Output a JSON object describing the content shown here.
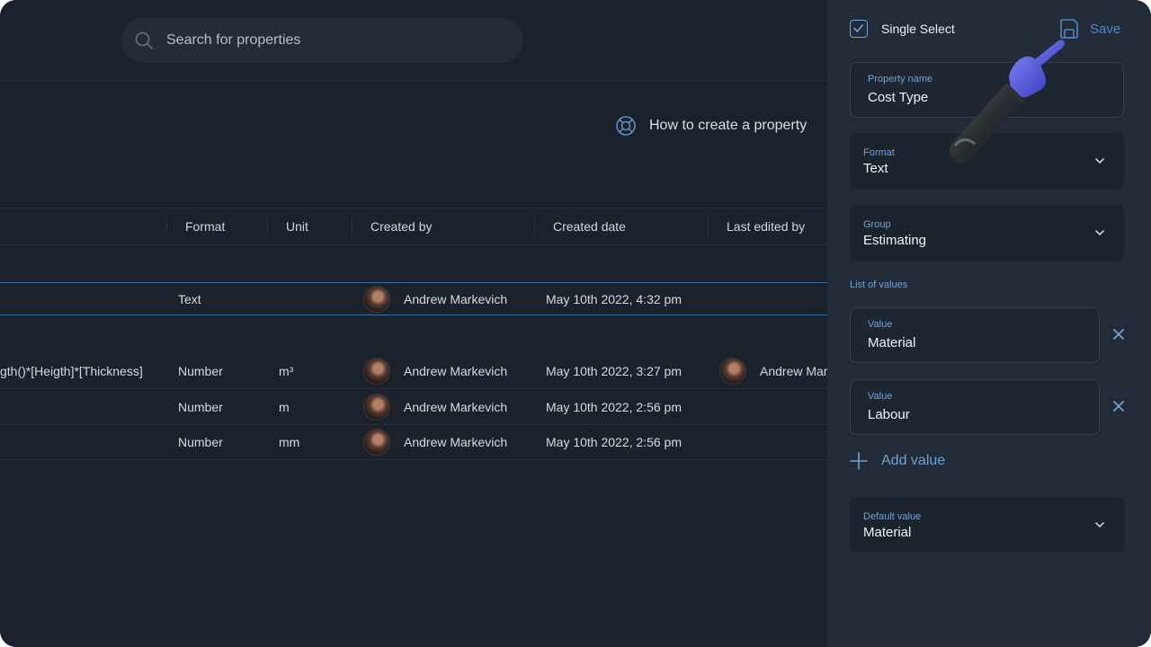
{
  "search": {
    "placeholder": "Search for properties"
  },
  "help": {
    "label": "How to create a property"
  },
  "table": {
    "headers": [
      "Format",
      "Unit",
      "Created by",
      "Created date",
      "Last edited by"
    ],
    "rows": [
      {
        "formula": "",
        "format": "Text",
        "unit": "",
        "created_by": "Andrew Markevich",
        "created_date": "May 10th 2022, 4:32 pm",
        "last_edited_by": ""
      },
      {
        "formula": "gth()*[Heigth]*[Thickness]",
        "format": "Number",
        "unit": "m³",
        "created_by": "Andrew Markevich",
        "created_date": "May 10th 2022, 3:27 pm",
        "last_edited_by": "Andrew Mar"
      },
      {
        "formula": "",
        "format": "Number",
        "unit": "m",
        "created_by": "Andrew Markevich",
        "created_date": "May 10th 2022, 2:56 pm",
        "last_edited_by": ""
      },
      {
        "formula": "",
        "format": "Number",
        "unit": "mm",
        "created_by": "Andrew Markevich",
        "created_date": "May 10th 2022, 2:56 pm",
        "last_edited_by": ""
      }
    ]
  },
  "panel": {
    "single_select_label": "Single Select",
    "single_select_checked": true,
    "save_label": "Save",
    "property_name": {
      "label": "Property name",
      "value": "Cost Type"
    },
    "format": {
      "label": "Format",
      "value": "Text"
    },
    "group": {
      "label": "Group",
      "value": "Estimating"
    },
    "list_of_values_label": "List of values",
    "values": [
      {
        "label": "Value",
        "value": "Material"
      },
      {
        "label": "Value",
        "value": "Labour"
      }
    ],
    "add_value_label": "Add value",
    "default_value": {
      "label": "Default value",
      "value": "Material"
    }
  },
  "colors": {
    "background": "#1b222c",
    "panel": "#222b37",
    "accent": "#6fa3d8",
    "selected_row_border": "#3d6d9e"
  },
  "icons": [
    "search-icon",
    "lifebuoy-icon",
    "checkbox-icon",
    "save-icon",
    "chevron-down-icon",
    "close-icon",
    "plus-icon",
    "pointing-hand-icon"
  ]
}
